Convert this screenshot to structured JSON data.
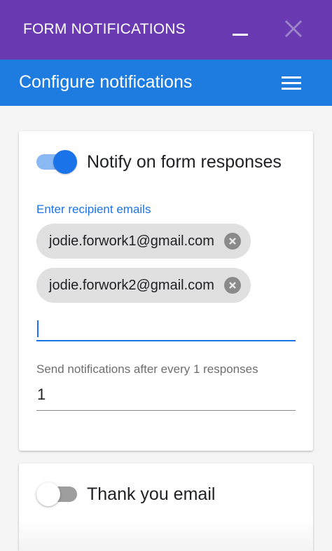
{
  "titlebar": {
    "title": "FORM NOTIFICATIONS",
    "minimize_icon": "minimize-icon",
    "close_icon": "close-icon"
  },
  "appbar": {
    "heading": "Configure notifications",
    "menu_icon": "hamburger-menu-icon"
  },
  "responses_card": {
    "toggle_on": true,
    "toggle_label": "Notify on form responses",
    "recipients_label": "Enter recipient emails",
    "recipients": [
      {
        "email": "jodie.forwork1@gmail.com",
        "remove_icon": "close-circle-icon"
      },
      {
        "email": "jodie.forwork2@gmail.com",
        "remove_icon": "close-circle-icon"
      }
    ],
    "email_input_value": "",
    "frequency_label": "Send notifications after every 1 responses",
    "frequency_value": "1"
  },
  "thank_you_card": {
    "toggle_on": false,
    "toggle_label": "Thank you email"
  },
  "colors": {
    "titlebar": "#6a3ab2",
    "appbar": "#1e7be0",
    "accent": "#1a73e8",
    "chip": "#e0e0e0"
  }
}
